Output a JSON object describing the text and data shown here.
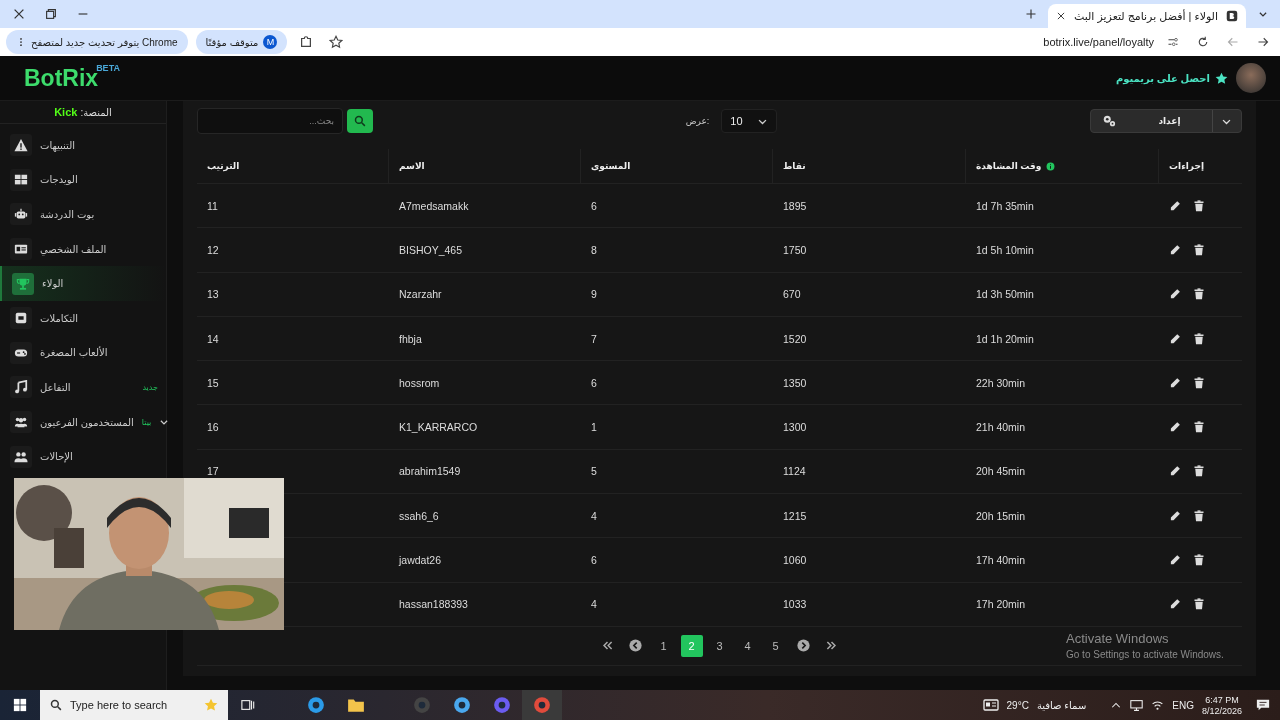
{
  "browser": {
    "tab_title": "الولاء | أفضل برنامج لتعزيز البث",
    "url": "botrix.live/panel/loyalty",
    "profile_chip": "متوقف مؤقتًا",
    "profile_initial": "M",
    "update_chip": "يتوفر تحديث جديد لمتصفح Chrome"
  },
  "header": {
    "logo": "BotRix",
    "logo_badge": "BETA",
    "premium": "احصل على بريميوم"
  },
  "sidebar": {
    "platform_label": "المنصة:",
    "platform": "Kick",
    "items": [
      {
        "label": "التنبيهات",
        "kind": "warning",
        "selected": false
      },
      {
        "label": "الويدجات",
        "kind": "grid",
        "selected": false
      },
      {
        "label": "بوت الدردشة",
        "kind": "robot",
        "selected": false
      },
      {
        "label": "الملف الشخصي",
        "kind": "card",
        "selected": false
      },
      {
        "label": "الولاء",
        "kind": "trophy",
        "selected": true
      },
      {
        "label": "التكاملات",
        "kind": "square",
        "selected": false
      },
      {
        "label": "الألعاب المصغرة",
        "kind": "gamepad",
        "selected": false
      },
      {
        "label": "التفاعل",
        "kind": "music",
        "selected": false,
        "badge": "جديد"
      },
      {
        "label": "المستخدمون الفرعيون",
        "kind": "users",
        "selected": false,
        "badge": "بيتا",
        "expanded": false
      },
      {
        "label": "الإحالات",
        "kind": "people",
        "selected": false
      }
    ]
  },
  "toolbar": {
    "search_placeholder": "بحث...",
    "show_label": "عرض:",
    "page_size": "10",
    "setup_button": "إعداد"
  },
  "table": {
    "columns": [
      {
        "label": "إجراءات"
      },
      {
        "label": "وقت المشاهدة",
        "info": true
      },
      {
        "label": "نقاط"
      },
      {
        "label": "المستوى"
      },
      {
        "label": "الاسم"
      },
      {
        "label": "الترتيب"
      }
    ],
    "rows": [
      {
        "rank": "11",
        "name": "A7medsamakk",
        "level": "6",
        "points": "1895",
        "watch_time": "1d 7h 35min"
      },
      {
        "rank": "12",
        "name": "BISHOY_465",
        "level": "8",
        "points": "1750",
        "watch_time": "1d 5h 10min"
      },
      {
        "rank": "13",
        "name": "Nzarzahr",
        "level": "9",
        "points": "670",
        "watch_time": "1d 3h 50min"
      },
      {
        "rank": "14",
        "name": "fhbja",
        "level": "7",
        "points": "1520",
        "watch_time": "1d 1h 20min"
      },
      {
        "rank": "15",
        "name": "hossrom",
        "level": "6",
        "points": "1350",
        "watch_time": "22h 30min"
      },
      {
        "rank": "16",
        "name": "K1_KARRARCO",
        "level": "1",
        "points": "1300",
        "watch_time": "21h 40min"
      },
      {
        "rank": "17",
        "name": "abrahim1549",
        "level": "5",
        "points": "1124",
        "watch_time": "20h 45min"
      },
      {
        "name": "ssah6_6",
        "level": "4",
        "points": "1215",
        "watch_time": "20h 15min"
      },
      {
        "name": "jawdat26",
        "level": "6",
        "points": "1060",
        "watch_time": "17h 40min"
      },
      {
        "name": "hassan188393",
        "level": "4",
        "points": "1033",
        "watch_time": "17h 20min"
      }
    ]
  },
  "pagination": {
    "pages": [
      {
        "label": "5",
        "selected": false
      },
      {
        "label": "4",
        "selected": false
      },
      {
        "label": "3",
        "selected": false
      },
      {
        "label": "2",
        "selected": true
      },
      {
        "label": "1",
        "selected": false
      }
    ]
  },
  "activation": {
    "title": "Activate Windows",
    "text": "Go to Settings to activate Windows."
  },
  "taskbar": {
    "search_placeholder": "Type here to search",
    "temperature": "29°C",
    "weather": "سماء صافية",
    "language": "ENG",
    "time": "6:47 PM",
    "date": "8/12/2026"
  }
}
